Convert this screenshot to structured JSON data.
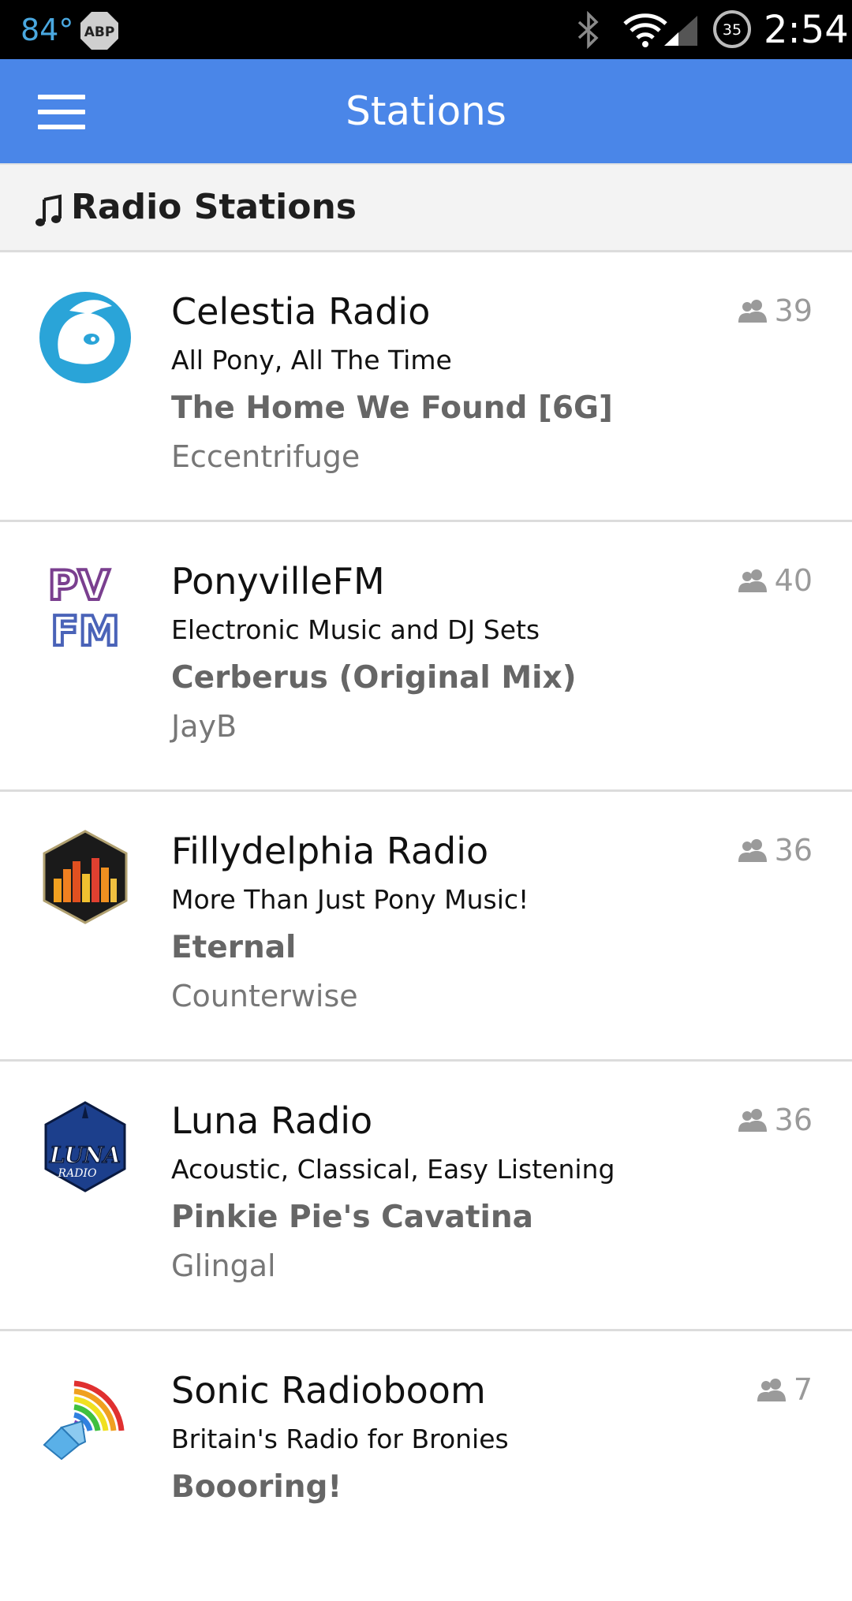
{
  "status_bar": {
    "temperature": "84°",
    "abp_label": "ABP",
    "battery_level": "35",
    "time": "2:54"
  },
  "app_bar": {
    "title": "Stations",
    "menu_icon": "hamburger-menu-icon"
  },
  "section": {
    "icon": "music-note-icon",
    "title": "Radio Stations"
  },
  "stations": [
    {
      "name": "Celestia Radio",
      "description": "All Pony, All The Time",
      "song": "The Home We Found [6G]",
      "artist": "Eccentrifuge",
      "listeners": "39"
    },
    {
      "name": "PonyvilleFM",
      "description": "Electronic Music and DJ Sets",
      "song": "Cerberus (Original Mix)",
      "artist": "JayB",
      "listeners": "40",
      "logo_text_top": "PV",
      "logo_text_bottom": "FM"
    },
    {
      "name": "Fillydelphia Radio",
      "description": "More Than Just Pony Music!",
      "song": "Eternal",
      "artist": "Counterwise",
      "listeners": "36"
    },
    {
      "name": "Luna Radio",
      "description": "Acoustic, Classical, Easy Listening",
      "song": "Pinkie Pie's Cavatina",
      "artist": "Glingal",
      "listeners": "36",
      "logo_text_top": "LUNA",
      "logo_text_bottom": "RADIO"
    },
    {
      "name": "Sonic Radioboom",
      "description": "Britain's Radio for Bronies",
      "song": "Boooring!",
      "artist": "",
      "listeners": "7"
    }
  ],
  "colors": {
    "app_bar": "#4a86e8",
    "status_bar": "#000000",
    "section_bg": "#f3f3f3"
  }
}
